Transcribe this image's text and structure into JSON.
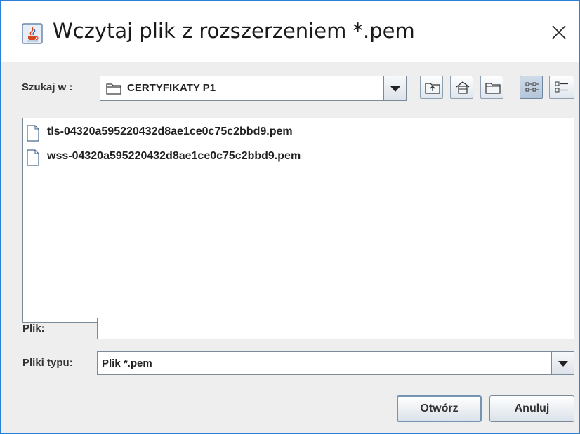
{
  "window": {
    "title": "Wczytaj plik z rozszerzeniem *.pem",
    "app_icon": "java-cup-icon",
    "close_icon": "close-icon"
  },
  "look_in": {
    "label": "Szukaj w :",
    "value": "CERTYFIKATY P1",
    "folder_icon": "folder-icon"
  },
  "toolbar": {
    "buttons": [
      {
        "name": "up-one-level-button",
        "icon": "folder-up-icon"
      },
      {
        "name": "home-button",
        "icon": "home-icon"
      },
      {
        "name": "new-folder-button",
        "icon": "new-folder-icon"
      },
      {
        "name": "list-view-button",
        "icon": "list-view-icon",
        "active": true
      },
      {
        "name": "details-view-button",
        "icon": "details-view-icon",
        "active": false
      }
    ]
  },
  "files": [
    {
      "name": "tls-04320a595220432d8ae1ce0c75c2bbd9.pem",
      "icon": "file-icon"
    },
    {
      "name": "wss-04320a595220432d8ae1ce0c75c2bbd9.pem",
      "icon": "file-icon"
    }
  ],
  "file_name": {
    "label": "Plik:",
    "value": "",
    "placeholder": ""
  },
  "file_type": {
    "label_prefix": "Pliki ",
    "label_mnemonic": "t",
    "label_suffix": "ypu:",
    "value": "Plik *.pem"
  },
  "actions": {
    "open_label": "Otwórz",
    "cancel_label": "Anuluj"
  },
  "colors": {
    "window_border": "#2b7fd6",
    "dialog_background": "#eeeeee",
    "active_toggle": "#b4c6da"
  }
}
